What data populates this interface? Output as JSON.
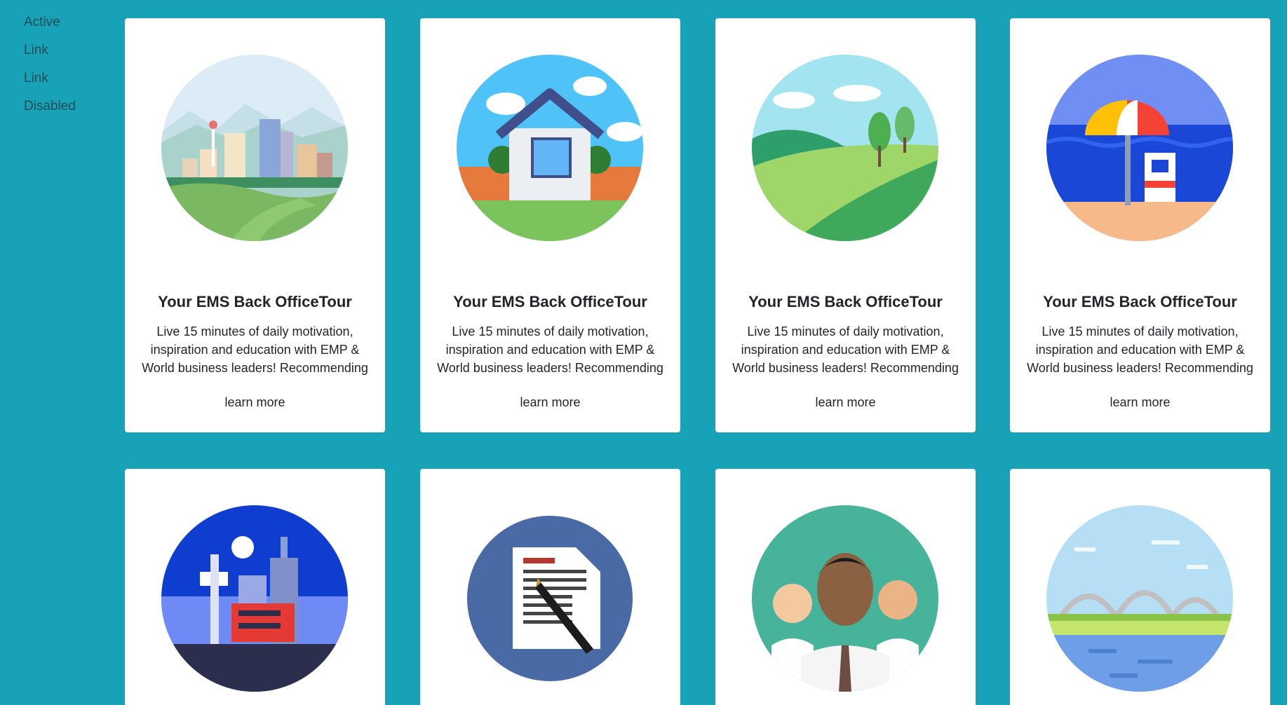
{
  "nav": {
    "items": [
      {
        "label": "Active"
      },
      {
        "label": "Link"
      },
      {
        "label": "Link"
      },
      {
        "label": "Disabled"
      }
    ]
  },
  "cards": [
    {
      "title": "Your EMS Back OfficeTour",
      "text": "Live 15 minutes of daily motivation, inspiration and education with EMP & World business leaders! Recommending",
      "link": "learn more",
      "image": "city-skyline-illustration"
    },
    {
      "title": "Your EMS Back OfficeTour",
      "text": "Live 15 minutes of daily motivation, inspiration and education with EMP & World business leaders! Recommending",
      "link": "learn more",
      "image": "house-illustration"
    },
    {
      "title": "Your EMS Back OfficeTour",
      "text": "Live 15 minutes of daily motivation, inspiration and education with EMP & World business leaders! Recommending",
      "link": "learn more",
      "image": "landscape-hills-illustration"
    },
    {
      "title": "Your EMS Back OfficeTour",
      "text": "Live 15 minutes of daily motivation, inspiration and education with EMP & World business leaders! Recommending",
      "link": "learn more",
      "image": "beach-umbrella-illustration"
    },
    {
      "image": "night-city-tower-illustration"
    },
    {
      "image": "document-pen-illustration"
    },
    {
      "image": "business-team-illustration"
    },
    {
      "image": "bridge-river-illustration"
    }
  ]
}
